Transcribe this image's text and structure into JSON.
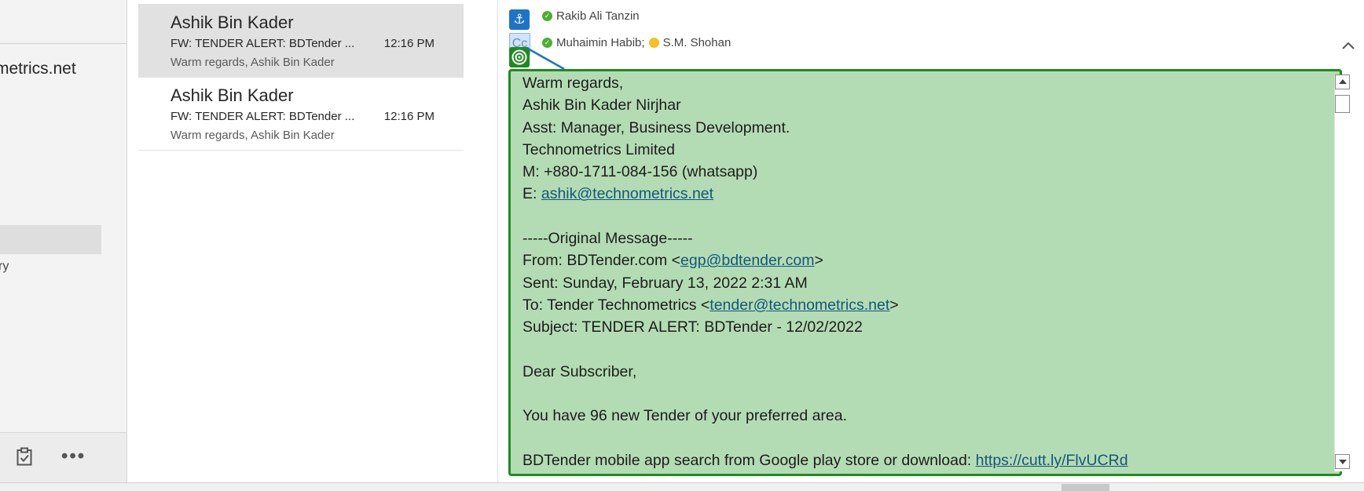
{
  "folder_pane": {
    "account_name": "metrics.net",
    "folder_item": "ry"
  },
  "message_list": [
    {
      "sender": "Ashik Bin Kader",
      "subject": "FW: TENDER ALERT: BDTender ...",
      "time": "12:16 PM",
      "preview": "Warm regards,  Ashik Bin Kader",
      "selected": true
    },
    {
      "sender": "Ashik Bin Kader",
      "subject": "FW: TENDER ALERT: BDTender ...",
      "time": "12:16 PM",
      "preview": "Warm regards,  Ashik Bin Kader",
      "selected": false
    }
  ],
  "reading_pane": {
    "to_recipients": "Rakib Ali Tanzin",
    "cc_label": "Cc",
    "cc_recipient_1": "Muhaimin Habib;",
    "cc_recipient_2": "S.M. Shohan",
    "body": {
      "closing": "Warm regards,",
      "sig_name": "Ashik Bin Kader Nirjhar",
      "sig_title": "Asst: Manager, Business Development.",
      "sig_company": "Technometrics Limited",
      "sig_mobile": "M: +880-1711-084-156 (whatsapp)",
      "sig_email_prefix": "E: ",
      "sig_email": "ashik@technometrics.net",
      "original_header": "-----Original Message-----",
      "from_prefix": "From: BDTender.com <",
      "from_email": "egp@bdtender.com",
      "from_suffix": ">",
      "sent": "Sent: Sunday, February 13, 2022 2:31 AM",
      "to_prefix": "To: Tender Technometrics <",
      "to_email": "tender@technometrics.net",
      "to_suffix": ">",
      "subject": "Subject: TENDER ALERT: BDTender - 12/02/2022",
      "greeting": "Dear Subscriber,",
      "message": "You have 96 new Tender of your preferred area.",
      "app_text": "BDTender mobile app search from Google play store or download: ",
      "app_link": "https://cutt.ly/FlvUCRd"
    }
  },
  "colors": {
    "body_highlight": "#b4dcb4",
    "body_border": "#1d8c1d",
    "anchor_icon": "#1e73c8",
    "link": "#13567d"
  }
}
